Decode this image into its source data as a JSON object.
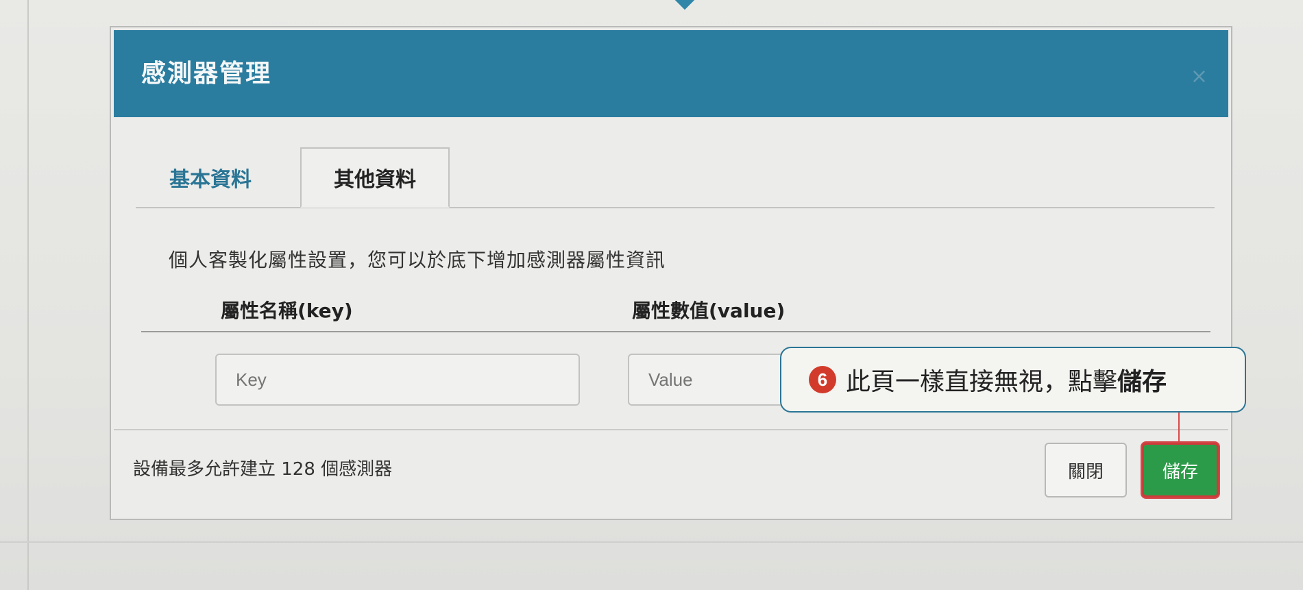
{
  "dialog": {
    "title": "感測器管理",
    "close_icon": "×"
  },
  "tabs": [
    {
      "label": "基本資料",
      "active": false
    },
    {
      "label": "其他資料",
      "active": true
    }
  ],
  "content": {
    "description": "個人客製化屬性設置，您可以於底下增加感測器屬性資訊",
    "columns": {
      "key_header": "屬性名稱(key)",
      "value_header": "屬性數值(value)"
    },
    "fields": {
      "key_placeholder": "Key",
      "value_placeholder": "Value"
    }
  },
  "footer": {
    "note": "設備最多允許建立 128 個感測器",
    "close_label": "關閉",
    "save_label": "儲存"
  },
  "annotation": {
    "step_number": "6",
    "text": "此頁一樣直接無視，點擊",
    "highlight": "儲存"
  },
  "colors": {
    "header": "#2a7d9f",
    "accent": "#2a7595",
    "save_button": "#2c9b49",
    "highlight_border": "#cf3a3a",
    "step_badge": "#d23b2b"
  }
}
